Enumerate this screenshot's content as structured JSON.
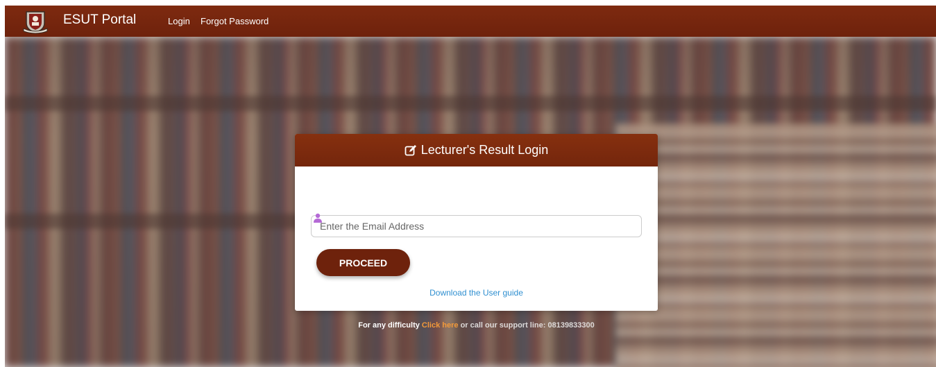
{
  "navbar": {
    "brand_name": "ESUT Portal",
    "links": [
      "Login",
      "Forgot Password"
    ],
    "color": "#7a2810"
  },
  "login_card": {
    "title": "Lecturer's Result Login",
    "title_icon": "edit-icon",
    "email": {
      "placeholder": "Enter the Email Address",
      "value": "",
      "icon": "user-icon"
    },
    "proceed_label": "PROCEED",
    "guide_link": "Download the User guide"
  },
  "footer": {
    "prefix": "For any difficulty ",
    "click_here": "Click here",
    "suffix": " or call our support line: 08139833300"
  },
  "colors": {
    "primary": "#6e220c",
    "link": "#2f8fd0",
    "accent": "#f2993a"
  }
}
